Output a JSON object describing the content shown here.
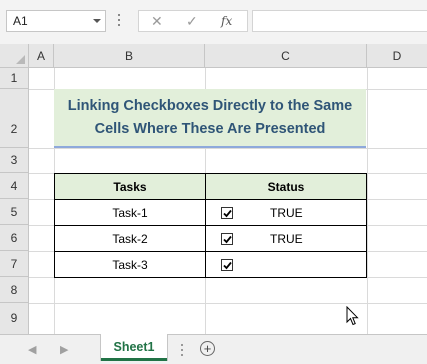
{
  "formula_bar": {
    "name_box": "A1",
    "cancel_icon": "x-icon",
    "enter_icon": "check-icon",
    "function_label": "fx",
    "formula": ""
  },
  "columns": [
    "A",
    "B",
    "C",
    "D"
  ],
  "rows": [
    "1",
    "2",
    "3",
    "4",
    "5",
    "6",
    "7",
    "8",
    "9"
  ],
  "title": {
    "line1": "Linking Checkboxes Directly to the Same",
    "line2": "Cells Where These Are Presented"
  },
  "table": {
    "headers": [
      "Tasks",
      "Status"
    ],
    "rows": [
      {
        "task": "Task-1",
        "checked": true,
        "value": "TRUE"
      },
      {
        "task": "Task-2",
        "checked": true,
        "value": "TRUE"
      },
      {
        "task": "Task-3",
        "checked": true,
        "value": ""
      }
    ]
  },
  "sheets": {
    "active": "Sheet1",
    "add_icon": "plus-circle-icon"
  },
  "colors": {
    "header_fill": "#e2efda",
    "title_text": "#2f5577",
    "title_underline": "#8ea9db",
    "tab_accent": "#217346"
  }
}
